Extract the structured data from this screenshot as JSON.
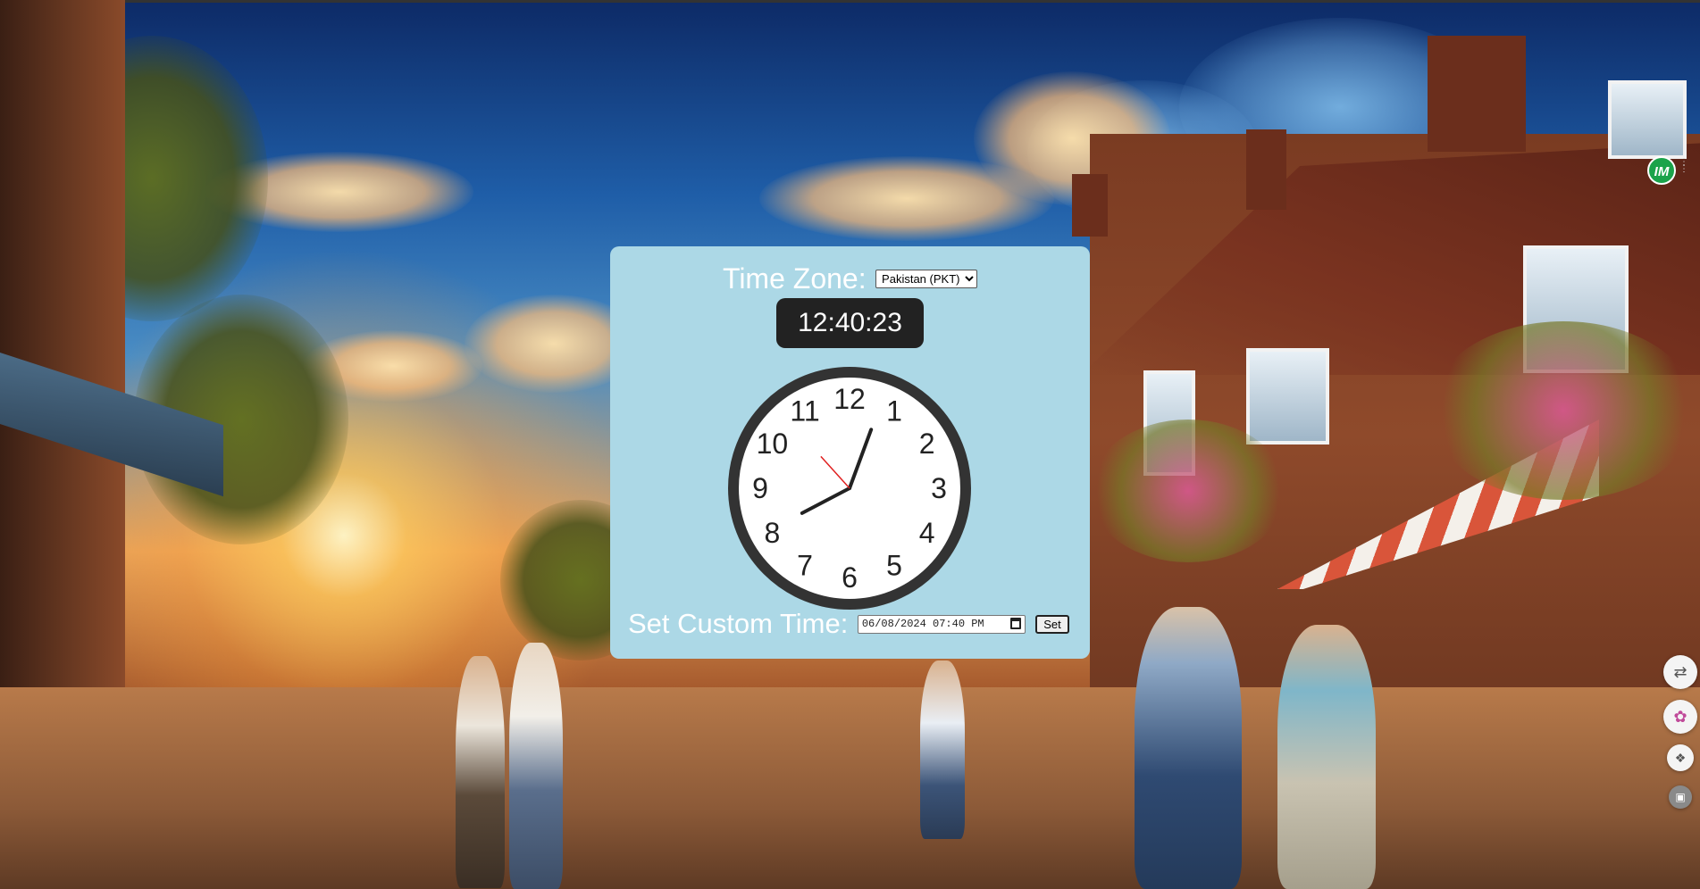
{
  "timezone": {
    "label": "Time Zone:",
    "selected": "Pakistan (PKT)"
  },
  "digital_clock": {
    "time": "12:40:23"
  },
  "analog_clock": {
    "numbers": [
      "12",
      "1",
      "2",
      "3",
      "4",
      "5",
      "6",
      "7",
      "8",
      "9",
      "10",
      "11"
    ],
    "time": {
      "hour": 12,
      "minute": 40,
      "second": 23
    },
    "colors": {
      "face": "#ffffff",
      "rim": "#333333",
      "hands": "#222222",
      "second_hand": "#e02020"
    }
  },
  "custom_time": {
    "label": "Set Custom Time:",
    "value": "06/08/2024 07:40 PM",
    "button_label": "Set"
  },
  "extensions": {
    "im_badge": "IM"
  },
  "colors": {
    "panel_bg": "#acd8e6",
    "digital_bg": "#222222",
    "ext_green": "#1aa34a"
  }
}
